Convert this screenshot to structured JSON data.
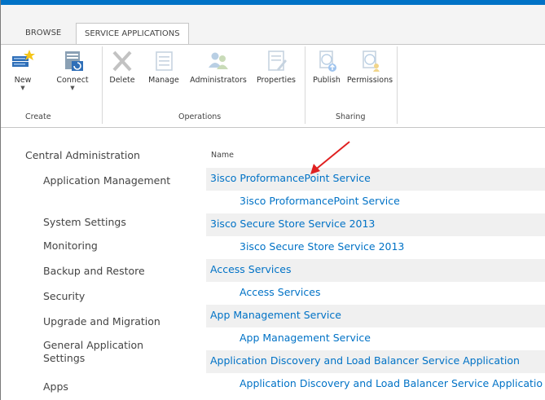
{
  "tabs": {
    "browse": "BROWSE",
    "service_applications": "SERVICE APPLICATIONS"
  },
  "ribbon": {
    "new": "New",
    "connect": "Connect",
    "delete": "Delete",
    "manage": "Manage",
    "administrators": "Administrators",
    "properties": "Properties",
    "publish": "Publish",
    "permissions": "Permissions",
    "groups": {
      "create": "Create",
      "operations": "Operations",
      "sharing": "Sharing"
    },
    "icons": [
      "new-service-icon",
      "connect-icon",
      "delete-icon",
      "manage-icon",
      "administrators-icon",
      "properties-icon",
      "publish-icon",
      "permissions-icon"
    ]
  },
  "nav": {
    "root": "Central Administration",
    "items": [
      "Application Management",
      "System Settings",
      "Monitoring",
      "Backup and Restore",
      "Security",
      "Upgrade and Migration",
      "General Application Settings",
      "Apps"
    ]
  },
  "list": {
    "column_header": "Name",
    "rows": [
      {
        "label": "3isco ProformancePoint Service",
        "level": "parent"
      },
      {
        "label": "3isco ProformancePoint Service",
        "level": "child"
      },
      {
        "label": "3isco Secure Store Service 2013",
        "level": "parent"
      },
      {
        "label": "3isco Secure Store Service 2013",
        "level": "child"
      },
      {
        "label": "Access Services",
        "level": "parent"
      },
      {
        "label": "Access Services",
        "level": "child"
      },
      {
        "label": "App Management Service",
        "level": "parent"
      },
      {
        "label": "App Management Service",
        "level": "child"
      },
      {
        "label": "Application Discovery and Load Balancer Service Application",
        "level": "parent"
      },
      {
        "label": "Application Discovery and Load Balancer Service Applicatio",
        "level": "child"
      }
    ]
  },
  "colors": {
    "accent": "#0072c6",
    "row_shade": "#f0f0f0",
    "annotation_arrow": "#e02020"
  }
}
